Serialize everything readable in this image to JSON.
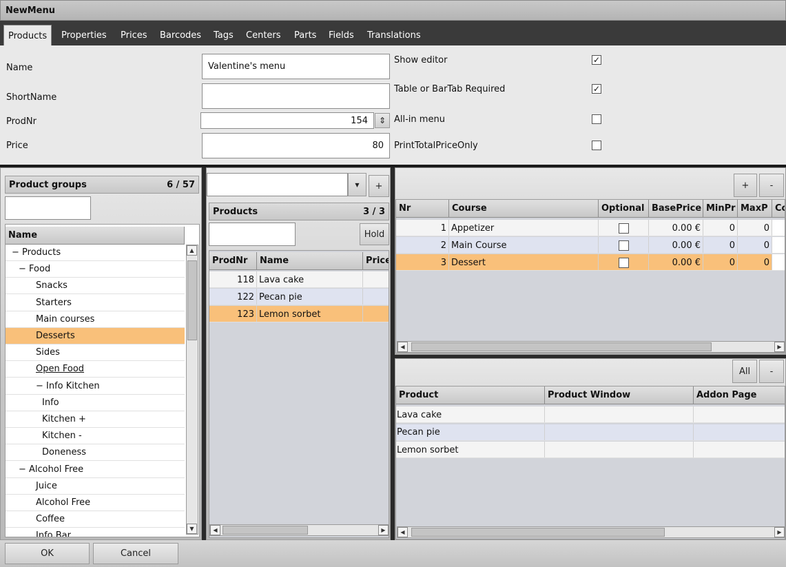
{
  "window": {
    "title": "NewMenu"
  },
  "tabs": [
    "Products",
    "Properties",
    "Prices",
    "Barcodes",
    "Tags",
    "Centers",
    "Parts",
    "Fields",
    "Translations"
  ],
  "form": {
    "name_label": "Name",
    "name_value": "Valentine's menu",
    "shortname_label": "ShortName",
    "shortname_value": "",
    "prodnr_label": "ProdNr",
    "prodnr_value": "154",
    "price_label": "Price",
    "price_value": "80",
    "show_editor_label": "Show editor",
    "show_editor_checked": true,
    "table_required_label": "Table or BarTab Required",
    "table_required_checked": true,
    "allin_label": "All-in menu",
    "allin_checked": false,
    "print_total_label": "PrintTotalPriceOnly",
    "print_total_checked": false,
    "check_mark": "✓"
  },
  "groups": {
    "title": "Product groups",
    "count": "6  /  57",
    "column": "Name",
    "items": [
      {
        "label": "− Products",
        "indent": 0
      },
      {
        "label": "− Food",
        "indent": 1
      },
      {
        "label": "Snacks",
        "indent": 2
      },
      {
        "label": "Starters",
        "indent": 2
      },
      {
        "label": "Main courses",
        "indent": 2
      },
      {
        "label": "Desserts",
        "indent": 2,
        "selected": true
      },
      {
        "label": "Sides",
        "indent": 2
      },
      {
        "label": "Open Food",
        "indent": 2,
        "underline": true
      },
      {
        "label": "− Info Kitchen",
        "indent": 2
      },
      {
        "label": "Info",
        "indent": 3
      },
      {
        "label": "Kitchen +",
        "indent": 3
      },
      {
        "label": "Kitchen -",
        "indent": 3
      },
      {
        "label": "Doneness",
        "indent": 3
      },
      {
        "label": "− Alcohol Free",
        "indent": 1
      },
      {
        "label": "Juice",
        "indent": 2
      },
      {
        "label": "Alcohol Free",
        "indent": 2
      },
      {
        "label": "Coffee",
        "indent": 2
      },
      {
        "label": "Info Bar",
        "indent": 2
      }
    ]
  },
  "products": {
    "title": "Products",
    "count": "3  /  3",
    "add_label": "+",
    "hold_label": "Hold",
    "columns": [
      "ProdNr",
      "Name",
      "Price"
    ],
    "rows": [
      {
        "nr": "118",
        "name": "Lava cake",
        "price": ""
      },
      {
        "nr": "122",
        "name": "Pecan pie",
        "price": ""
      },
      {
        "nr": "123",
        "name": "Lemon sorbet",
        "price": ""
      }
    ]
  },
  "courses": {
    "add_label": "+",
    "remove_label": "-",
    "columns": [
      "Nr",
      "Course",
      "Optional",
      "BasePrice",
      "MinPr",
      "MaxP",
      "Co"
    ],
    "rows": [
      {
        "nr": "1",
        "course": "Appetizer",
        "base": "0.00 €",
        "min": "0",
        "max": "0"
      },
      {
        "nr": "2",
        "course": "Main Course",
        "base": "0.00 €",
        "min": "0",
        "max": "0"
      },
      {
        "nr": "3",
        "course": "Dessert",
        "base": "0.00 €",
        "min": "0",
        "max": "0"
      }
    ]
  },
  "course_products": {
    "all_label": "All",
    "remove_label": "-",
    "columns": [
      "Product",
      "Product Window",
      "Addon Page"
    ],
    "rows": [
      {
        "product": "Lava cake"
      },
      {
        "product": "Pecan pie"
      },
      {
        "product": "Lemon sorbet"
      }
    ]
  },
  "footer": {
    "ok_label": "OK",
    "cancel_label": "Cancel"
  },
  "icons": {
    "scroll_left": "◀",
    "scroll_right": "▶",
    "scroll_up": "▲",
    "scroll_down": "▼",
    "dropdown": "▼",
    "spin": "⇕"
  }
}
